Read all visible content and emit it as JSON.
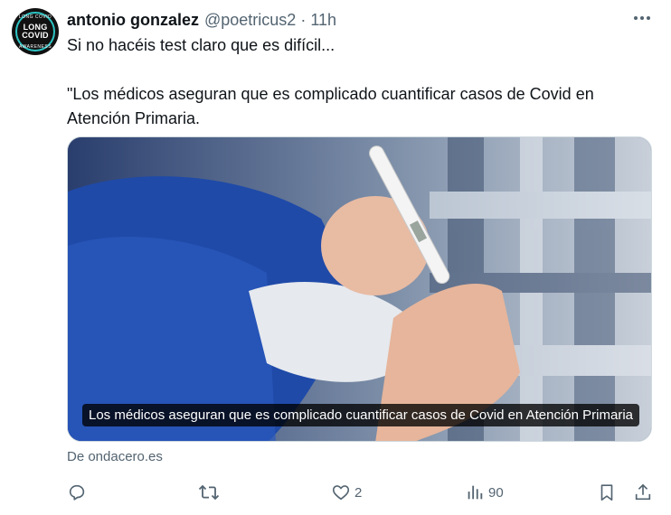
{
  "avatar": {
    "line1": "LONG",
    "line2": "COVID",
    "arc_top": "LONG COVID",
    "arc_bottom": "AWARENESS"
  },
  "author": {
    "name": "antonio gonzalez",
    "handle": "@poetricus2",
    "separator": "·",
    "time": "11h"
  },
  "tweet": {
    "line1": "Si no hacéis test claro que es difícil...",
    "line2": "\"Los médicos aseguran que es complicado cuantificar casos de Covid en Atención Primaria."
  },
  "card": {
    "caption": "Los médicos aseguran que es complicado cuantificar casos de Covid en Atención Primaria",
    "source": "De ondacero.es"
  },
  "actions": {
    "reply_icon": "reply-icon",
    "retweet_icon": "retweet-icon",
    "like_icon": "heart-icon",
    "like_count": "2",
    "views_icon": "views-icon",
    "views_count": "90",
    "bookmark_icon": "bookmark-icon",
    "share_icon": "share-icon"
  },
  "colors": {
    "text": "#0f1419",
    "secondary": "#536471",
    "border": "#cfd9de"
  }
}
